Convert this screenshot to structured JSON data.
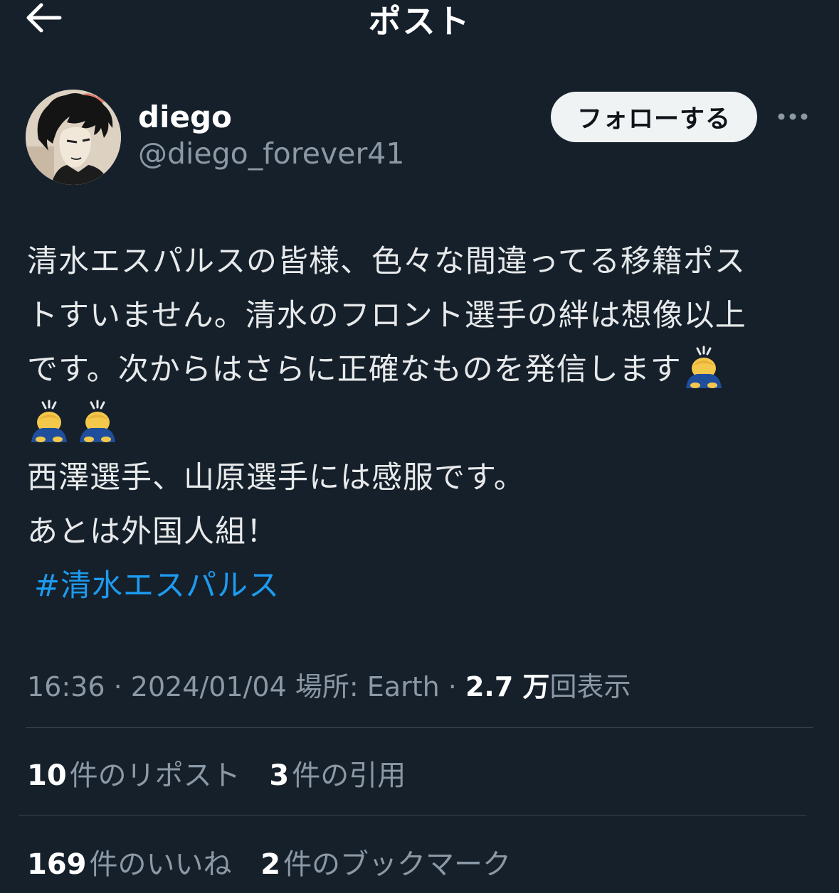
{
  "header": {
    "title": "ポスト"
  },
  "author": {
    "display_name": "diego",
    "handle": "@diego_forever41",
    "follow_label": "フォローする"
  },
  "post": {
    "lines": [
      "清水エスパルスの皆様、色々な間違ってる移籍ポス",
      "トすいません。清水のフロント選手の絆は想像以上",
      "です。次からはさらに正確なものを発信します",
      "",
      "西澤選手、山原選手には感服です。",
      "あとは外国人組！"
    ],
    "emoji_name": "person-bowing-emoji",
    "hashtag": "#清水エスパルス"
  },
  "meta": {
    "time": "16:36",
    "separator": " · ",
    "date": "2024/01/04",
    "location": "場所: Earth",
    "views_count": "2.7 万",
    "views_label": "回表示"
  },
  "stats": {
    "reposts_count": "10",
    "reposts_label": "件のリポスト",
    "quotes_count": "3",
    "quotes_label": "件の引用",
    "likes_count": "169",
    "likes_label": "件のいいね",
    "bookmarks_count": "2",
    "bookmarks_label": "件のブックマーク"
  },
  "colors": {
    "background": "#15202b",
    "text": "#e7e9ea",
    "secondary_text": "#8b98a5",
    "link": "#1d9bf0",
    "divider": "#38444d",
    "follow_button_bg": "#eff3f4"
  }
}
